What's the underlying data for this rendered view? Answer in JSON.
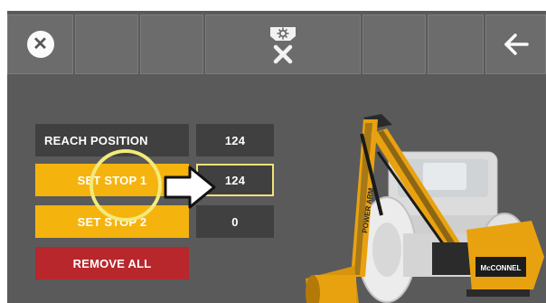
{
  "toolbar": {
    "close_icon": "close-circle-icon",
    "camera_icon": "flail-head-cancel-icon",
    "back_icon": "back-arrow-icon"
  },
  "reach": {
    "label": "REACH POSITION",
    "value": "124"
  },
  "stop1": {
    "label": "SET STOP 1",
    "value": "124"
  },
  "stop2": {
    "label": "SET STOP 2",
    "value": "0"
  },
  "remove": {
    "label": "REMOVE ALL"
  },
  "machine": {
    "arm_text": "POWER ARM",
    "logo_text": "McCONNEL"
  },
  "colors": {
    "background": "#5a5a5a",
    "button": "#6c6c6c",
    "yellow": "#f5b30e",
    "red": "#b8272c",
    "highlight": "#f0e27a"
  }
}
